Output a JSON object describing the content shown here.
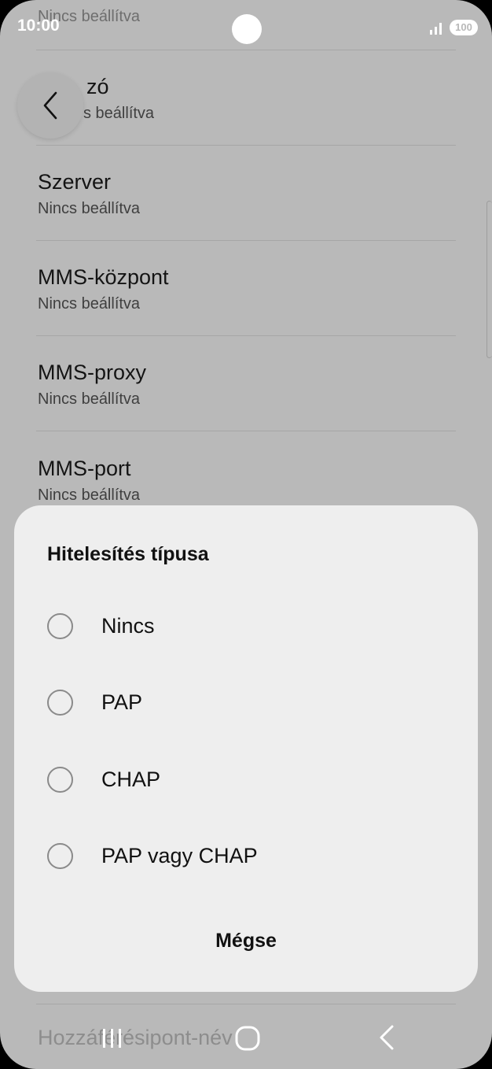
{
  "status_bar": {
    "time": "10:00",
    "battery": "100"
  },
  "list": {
    "partial_top": "Nincs beállítva",
    "items": [
      {
        "title": "zó",
        "sub": "s beállítva"
      },
      {
        "title": "Szerver",
        "sub": "Nincs beállítva"
      },
      {
        "title": "MMS-központ",
        "sub": "Nincs beállítva"
      },
      {
        "title": "MMS-proxy",
        "sub": "Nincs beállítva"
      },
      {
        "title": "MMS-port",
        "sub": "Nincs beállítva"
      }
    ],
    "bottom_item": "Hozzáférésipont-név"
  },
  "dialog": {
    "title": "Hitelesítés típusa",
    "options": [
      {
        "label": "Nincs",
        "selected": false
      },
      {
        "label": "PAP",
        "selected": false
      },
      {
        "label": "CHAP",
        "selected": false
      },
      {
        "label": "PAP vagy CHAP",
        "selected": false
      }
    ],
    "cancel_label": "Mégse"
  },
  "icons": {
    "back": "chevron-left-icon",
    "nav_recents": "recents-icon",
    "nav_home": "home-icon",
    "nav_back": "back-icon",
    "signal": "signal-icon",
    "battery": "battery-icon"
  },
  "colors": {
    "scrim": "#b9b9b9",
    "sheet": "#eeeeee",
    "text": "#111111"
  }
}
